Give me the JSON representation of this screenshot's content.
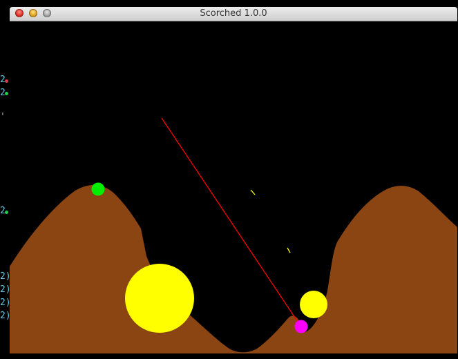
{
  "window": {
    "title": "Scorched 1.0.0"
  },
  "hud": {
    "rows": [
      {
        "text": "2",
        "dot_color": "#d03a4a"
      },
      {
        "text": "2",
        "dot_color": "#22cc44"
      },
      {
        "text": "'",
        "dot_color": ""
      },
      {
        "text": "2",
        "dot_color": "#22cc44"
      },
      {
        "text": "2)",
        "dot_color": ""
      },
      {
        "text": "2)",
        "dot_color": ""
      },
      {
        "text": "2)",
        "dot_color": ""
      },
      {
        "text": "2)",
        "dot_color": ""
      }
    ]
  },
  "colors": {
    "terrain": "#8b4513",
    "sky": "#000000",
    "tank_green": "#00ee00",
    "tank_magenta": "#ff00ff",
    "explosion": "#ffff00",
    "trajectory": "#ff0000",
    "debris": "#ffff00",
    "hud_text": "#5ec8e6"
  },
  "icons": {
    "close": "close-icon",
    "minimize": "minimize-icon",
    "zoom": "zoom-icon"
  }
}
